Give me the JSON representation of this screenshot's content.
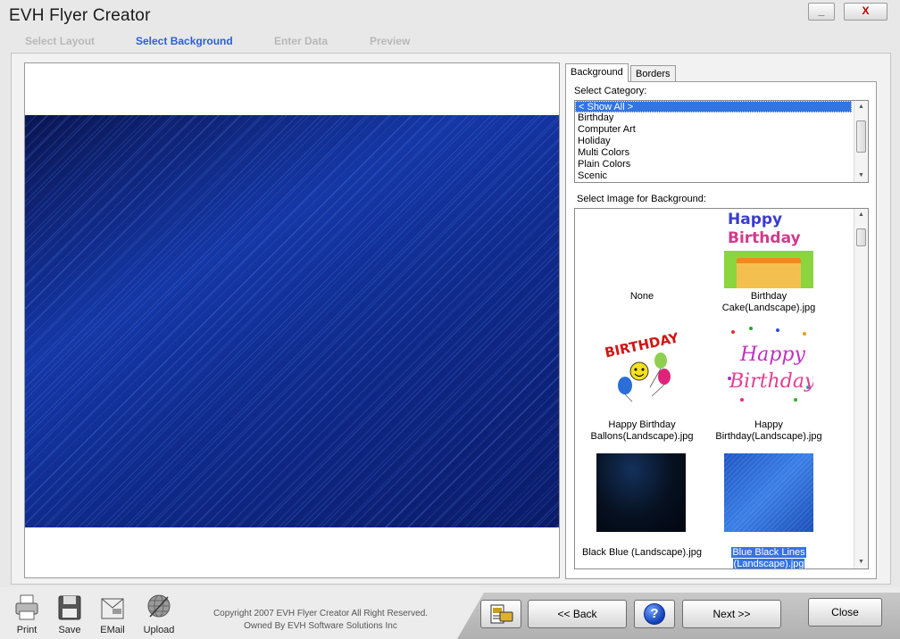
{
  "window": {
    "title": "EVH Flyer Creator",
    "minimize_label": "_",
    "close_label": "X"
  },
  "steps": [
    {
      "label": "Select Layout",
      "active": false
    },
    {
      "label": "Select Background",
      "active": true
    },
    {
      "label": "Enter Data",
      "active": false
    },
    {
      "label": "Preview",
      "active": false
    }
  ],
  "tabs": {
    "background": "Background",
    "borders": "Borders"
  },
  "category": {
    "label": "Select Category:",
    "items": [
      "< Show All >",
      "Birthday",
      "Computer Art",
      "Holiday",
      "Multi Colors",
      "Plain Colors",
      "Scenic"
    ],
    "selected": "< Show All >"
  },
  "images": {
    "label": "Select Image for Background:",
    "items": [
      {
        "line1": "None",
        "line2": ""
      },
      {
        "line1": "Birthday",
        "line2": "Cake(Landscape).jpg"
      },
      {
        "line1": "Happy Birthday",
        "line2": "Ballons(Landscape).jpg"
      },
      {
        "line1": "Happy",
        "line2": "Birthday(Landscape).jpg"
      },
      {
        "line1": "Black Blue (Landscape).jpg",
        "line2": ""
      },
      {
        "line1": "Blue Black Lines",
        "line2": "(Landscape).jpg"
      }
    ],
    "selected": "Blue Black Lines (Landscape).jpg",
    "thumb_text": {
      "cake_word1": "Happy",
      "cake_word2": "Birthday",
      "balloon_word": "BIRTHDAY",
      "hb_word1": "Happy",
      "hb_word2": "Birthday"
    }
  },
  "toolbar": {
    "print": "Print",
    "save": "Save",
    "email": "EMail",
    "upload": "Upload"
  },
  "copyright": {
    "line1": "Copyright 2007 EVH Flyer Creator All Right Reserved.",
    "line2": "Owned By EVH Software Solutions Inc"
  },
  "nav": {
    "back": "<< Back",
    "help": "?",
    "next": "Next >>",
    "close": "Close"
  }
}
